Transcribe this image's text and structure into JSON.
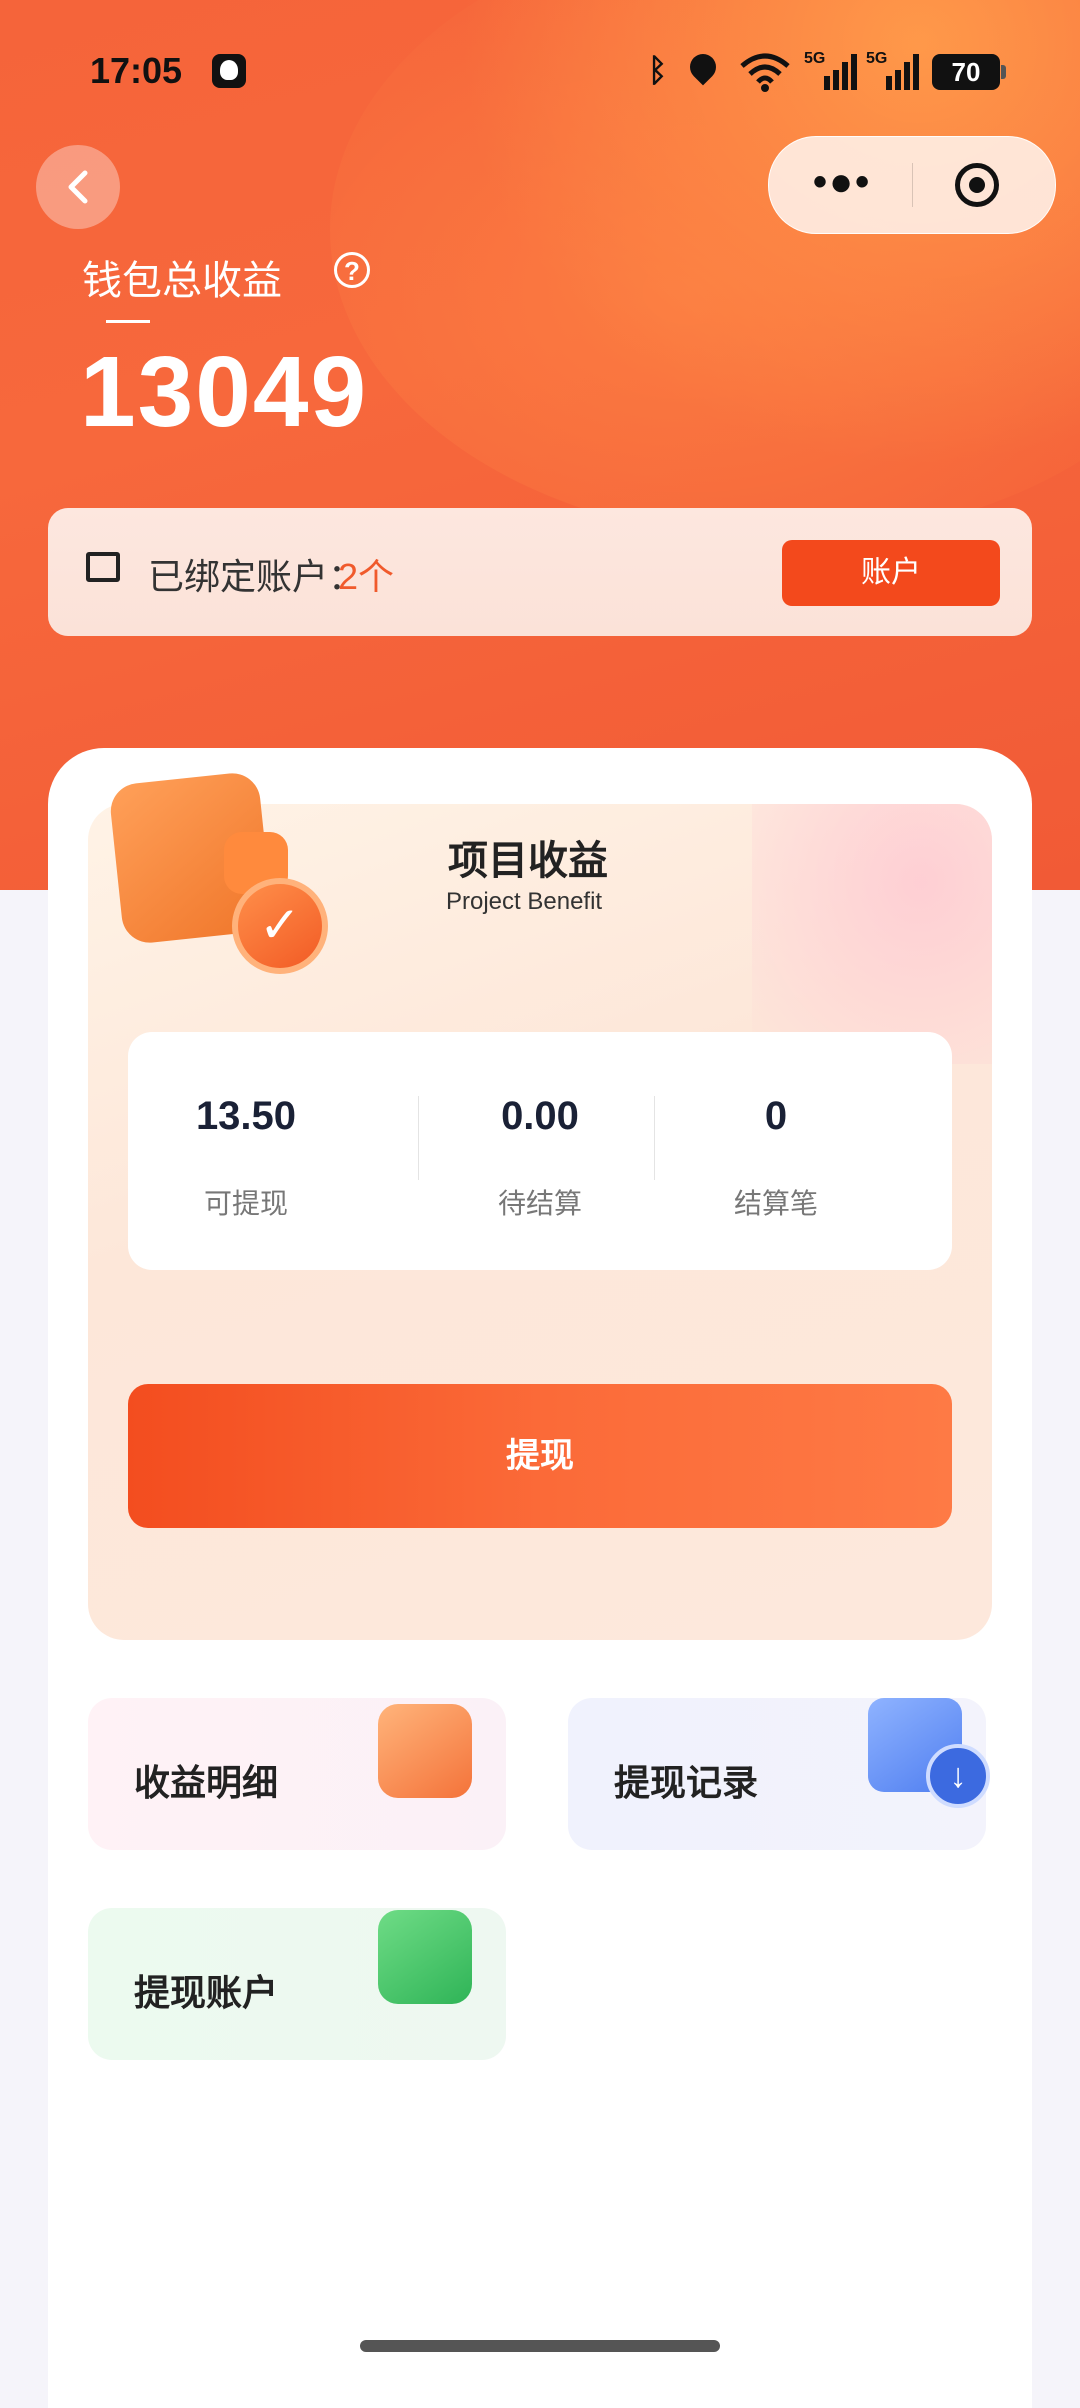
{
  "status_bar": {
    "time": "17:05",
    "battery": "70",
    "signal_1": "5G",
    "signal_2": "5G"
  },
  "nav": {
    "back_icon": "chevron-left-icon",
    "more_icon": "more-dots-icon",
    "close_icon": "target-circle-icon"
  },
  "header": {
    "total_label": "钱包总收益",
    "total_value": "13049",
    "help_icon": "?"
  },
  "account_bar": {
    "label": "已绑定账户：",
    "count": "2个",
    "button_label": "账户"
  },
  "project": {
    "title": "项目收益",
    "subtitle": "Project Benefit",
    "stats": [
      {
        "value": "13.50",
        "label": "可提现"
      },
      {
        "value": "0.00",
        "label": "待结算"
      },
      {
        "value": "0",
        "label": "结算笔"
      }
    ],
    "withdraw_label": "提现"
  },
  "tiles": [
    {
      "label": "收益明细"
    },
    {
      "label": "提现记录"
    },
    {
      "label": "提现账户"
    }
  ],
  "colors": {
    "brand": "#f3491c",
    "accent": "#f05a2c"
  }
}
